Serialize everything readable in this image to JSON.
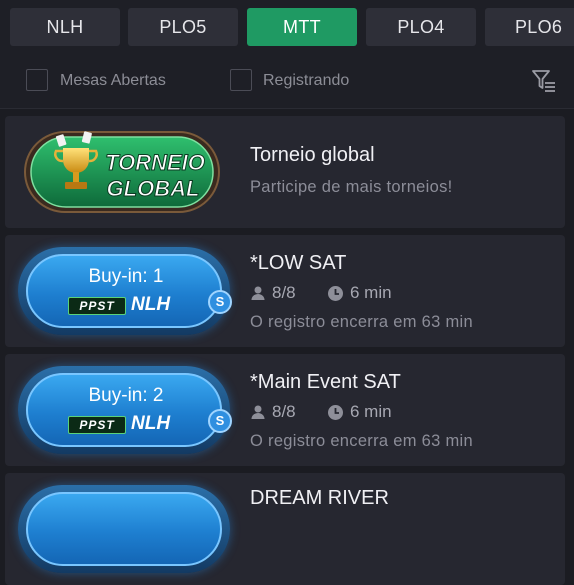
{
  "tabs": [
    {
      "label": "NLH",
      "active": false
    },
    {
      "label": "PLO5",
      "active": false
    },
    {
      "label": "MTT",
      "active": true
    },
    {
      "label": "PLO4",
      "active": false
    },
    {
      "label": "PLO6",
      "active": false
    }
  ],
  "filters": {
    "open_tables_label": "Mesas Abertas",
    "registering_label": "Registrando",
    "filter_icon": "filter-sort-icon"
  },
  "featured": {
    "logo_text_line1": "TORNEIO",
    "logo_text_line2": "GLOBAL",
    "title": "Torneio global",
    "subtitle": "Participe de mais torneios!"
  },
  "tournaments": [
    {
      "buyin_label": "Buy-in: 1",
      "brand": "PPST",
      "game": "NLH",
      "badge": "S",
      "name": "*LOW SAT",
      "players": "8/8",
      "duration": "6 min",
      "registration": "O registro encerra em 63 min"
    },
    {
      "buyin_label": "Buy-in: 2",
      "brand": "PPST",
      "game": "NLH",
      "badge": "S",
      "name": "*Main Event SAT",
      "players": "8/8",
      "duration": "6 min",
      "registration": "O registro encerra em 63 min"
    },
    {
      "name": "DREAM RIVER"
    }
  ],
  "colors": {
    "accent": "#1f9a63",
    "background": "#1b1c22",
    "card": "#262730",
    "buyin_blue": "#2a8ee0"
  }
}
